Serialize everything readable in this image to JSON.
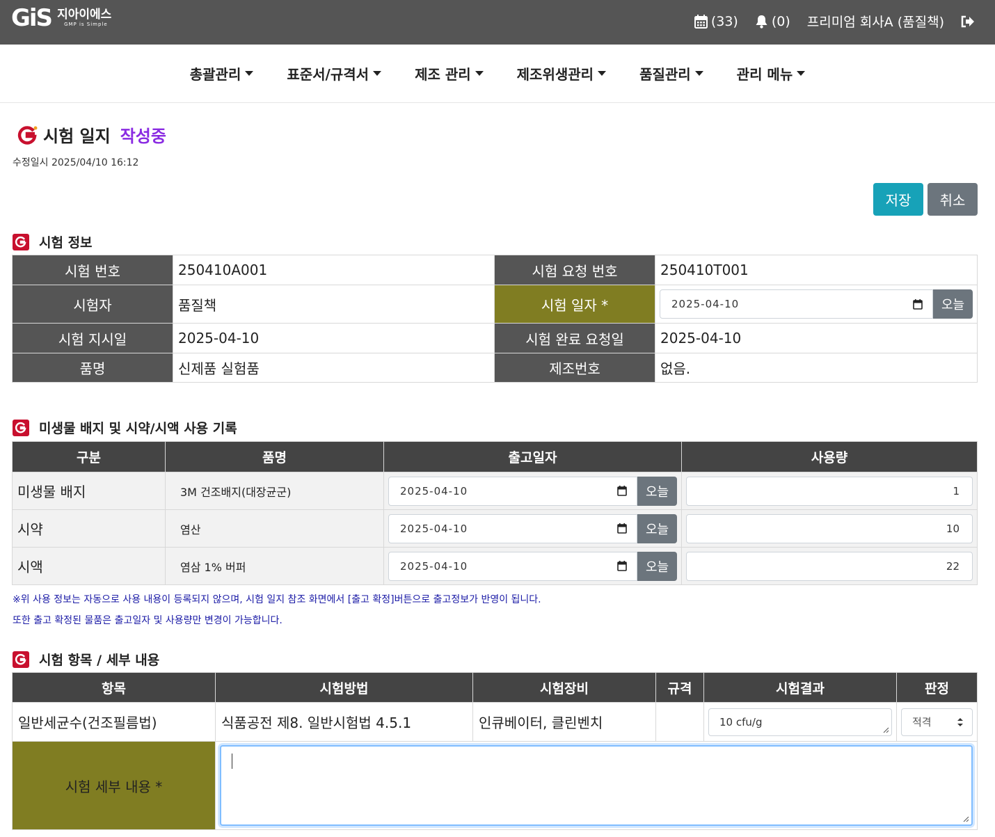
{
  "header": {
    "logo_mark": "GiS",
    "logo_kor": "지아이에스",
    "logo_sub": "GMP is Simple",
    "calendar_count": "(33)",
    "bell_count": "(0)",
    "user": "프리미엄 회사A (품질책)"
  },
  "nav": [
    "총괄관리",
    "표준서/규격서",
    "제조 관리",
    "제조위생관리",
    "품질관리",
    "관리 메뉴"
  ],
  "page": {
    "title": "시험 일지",
    "status": "작성중",
    "modified": "수정일시 2025/04/10 16:12",
    "save_label": "저장",
    "cancel_label": "취소"
  },
  "sections": {
    "info": "시험 정보",
    "usage": "미생물 배지 및 시약/시액 사용 기록",
    "items": "시험 항목 / 세부 내용"
  },
  "info": {
    "test_no_label": "시험 번호",
    "test_no": "250410A001",
    "request_no_label": "시험 요청 번호",
    "request_no": "250410T001",
    "tester_label": "시험자",
    "tester": "품질책",
    "test_date_label": "시험 일자 *",
    "test_date": "2025-04-10",
    "today_label": "오늘",
    "order_date_label": "시험 지시일",
    "order_date": "2025-04-10",
    "complete_date_label": "시험 완료 요청일",
    "complete_date": "2025-04-10",
    "product_label": "품명",
    "product": "신제품 실험품",
    "lot_label": "제조번호",
    "lot": "없음."
  },
  "usage": {
    "headers": [
      "구분",
      "품명",
      "출고일자",
      "사용량"
    ],
    "rows": [
      {
        "kind": "미생물 배지",
        "name": "3M 건조배지(대장균군)",
        "date": "2025-04-10",
        "today": "오늘",
        "qty": "1"
      },
      {
        "kind": "시약",
        "name": "염산",
        "date": "2025-04-10",
        "today": "오늘",
        "qty": "10"
      },
      {
        "kind": "시액",
        "name": "염삼 1% 버퍼",
        "date": "2025-04-10",
        "today": "오늘",
        "qty": "22"
      }
    ],
    "note1": "※위 사용 정보는 자동으로 사용 내용이 등록되지 않으며, 시험 일지 참조 화면에서 [출고 확정]버튼으로 출고정보가 반영이 됩니다.",
    "note2": "또한 출고 확정된 물품은 출고일자 및 사용량만 변경이 가능합니다."
  },
  "items": {
    "headers": [
      "항목",
      "시험방법",
      "시험장비",
      "규격",
      "시험결과",
      "판정"
    ],
    "row": {
      "item": "일반세균수(건조필름법)",
      "method": "식품공전 제8. 일반시험법 4.5.1",
      "equipment": "인큐베이터, 클린벤치",
      "spec": "",
      "result": "10 cfu/g",
      "judgement": "적격"
    },
    "detail_label": "시험 세부 내용 *",
    "detail_value": ""
  }
}
